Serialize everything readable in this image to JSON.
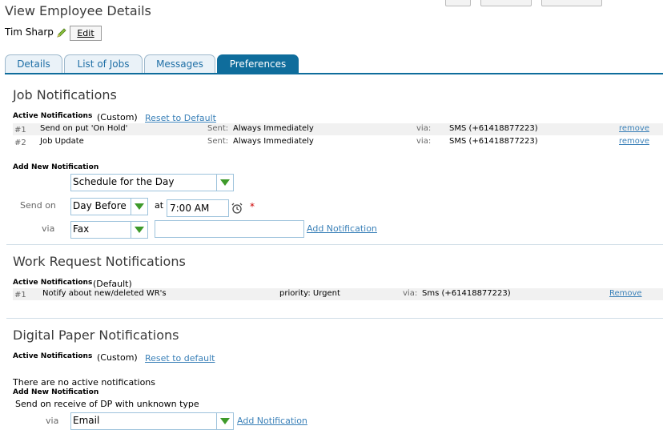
{
  "page": {
    "title": "View Employee Details"
  },
  "employee": {
    "name": "Tim Sharp",
    "edit_label": "Edit"
  },
  "tabs": [
    {
      "label": "Details"
    },
    {
      "label": "List of Jobs"
    },
    {
      "label": "Messages"
    },
    {
      "label": "Preferences",
      "active": true
    }
  ],
  "job_notifications": {
    "title": "Job Notifications",
    "active_label": "Active Notifications",
    "mode": "(Custom)",
    "reset_label": "Reset to Default",
    "rows": [
      {
        "num": "#1",
        "name": "Send on put 'On Hold'",
        "sent_label": "Sent:",
        "sent": "Always Immediately",
        "via_label": "via:",
        "via": "SMS (+61418877223)",
        "remove": "remove"
      },
      {
        "num": "#2",
        "name": "Job Update",
        "sent_label": "Sent:",
        "sent": "Always Immediately",
        "via_label": "via:",
        "via": "SMS (+61418877223)",
        "remove": "remove"
      }
    ],
    "add_new_label": "Add New Notification",
    "schedule_select": "Schedule for the Day",
    "send_on_label": "Send on",
    "send_on_select": "Day Before",
    "at_label": "at",
    "time_value": "7:00 AM",
    "required_mark": "*",
    "via_label": "via",
    "via_select": "Fax",
    "via_input_value": "",
    "add_label": "Add Notification"
  },
  "work_request_notifications": {
    "title": "Work Request Notifications",
    "active_label": "Active Notifications",
    "mode": "(Default)",
    "rows": [
      {
        "num": "#1",
        "name": "Notify about new/deleted WR's",
        "priority": "priority: Urgent",
        "via_label": "via:",
        "via": "Sms (+61418877223)",
        "remove": "Remove"
      }
    ]
  },
  "digital_paper_notifications": {
    "title": "Digital Paper Notifications",
    "active_label": "Active Notifications",
    "mode": "(Custom)",
    "reset_label": "Reset to default",
    "empty_text": "There are no active notifications",
    "add_new_label": "Add New Notification",
    "trigger_text": "Send on receive of DP with unknown type",
    "via_label": "via",
    "via_select": "Email",
    "add_label": "Add Notification"
  },
  "colors": {
    "accent": "#0f6d9c",
    "link": "#3a80b8",
    "dropdown_arrow": "#3e9a2a",
    "required": "#cc0000"
  }
}
